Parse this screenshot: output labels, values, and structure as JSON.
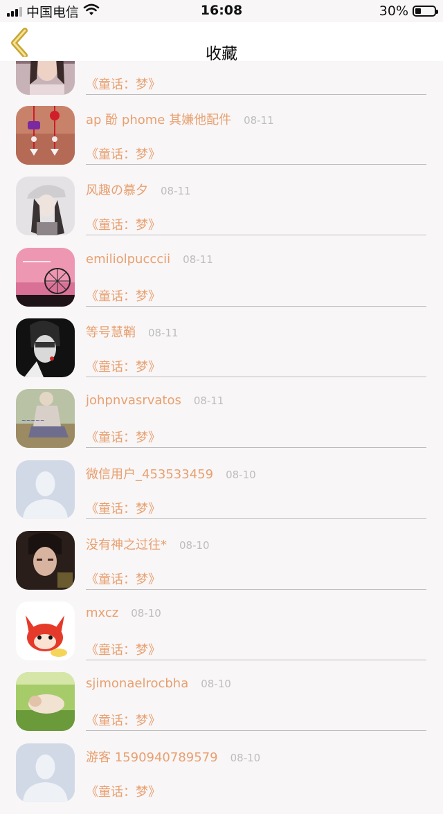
{
  "status_bar": {
    "carrier": "中国电信",
    "time": "16:08",
    "battery": "30%",
    "battery_level": 0.3
  },
  "nav": {
    "title": "收藏",
    "back_icon": "chevron-left-icon"
  },
  "items": [
    {
      "name": "",
      "date": "",
      "subtitle": "《童话：梦》",
      "avatar": "photo-girl"
    },
    {
      "name": "ap 酚 phome 其嫌他配件",
      "date": "08-11",
      "subtitle": "《童话：梦》",
      "avatar": "knot-ornaments"
    },
    {
      "name": "风趣の慕夕",
      "date": "08-11",
      "subtitle": "《童话：梦》",
      "avatar": "girl-cap"
    },
    {
      "name": "emiliolpucccii",
      "date": "08-11",
      "subtitle": "《童话：梦》",
      "avatar": "pink-ferris-wheel"
    },
    {
      "name": "等号慧鞘",
      "date": "08-11",
      "subtitle": "《童话：梦》",
      "avatar": "bw-portrait"
    },
    {
      "name": "johpnvasrvatos",
      "date": "08-11",
      "subtitle": "《童话：梦》",
      "avatar": "sitting-figure"
    },
    {
      "name": "微信用户_453533459",
      "date": "08-10",
      "subtitle": "《童话：梦》",
      "avatar": "default-user"
    },
    {
      "name": "没有神之过往*",
      "date": "08-10",
      "subtitle": "《童话：梦》",
      "avatar": "young-man"
    },
    {
      "name": "mxcz",
      "date": "08-10",
      "subtitle": "《童话：梦》",
      "avatar": "red-fox-cartoon"
    },
    {
      "name": "sjimonaelrocbha",
      "date": "08-10",
      "subtitle": "《童话：梦》",
      "avatar": "grass-photo"
    },
    {
      "name": "游客 1590940789579",
      "date": "08-10",
      "subtitle": "《童话：梦》",
      "avatar": "default-user"
    }
  ],
  "colors": {
    "accent": "#e8a070",
    "date": "#bdbdbd",
    "background": "#f8f6f7",
    "back_arrow": "#c9a530"
  }
}
